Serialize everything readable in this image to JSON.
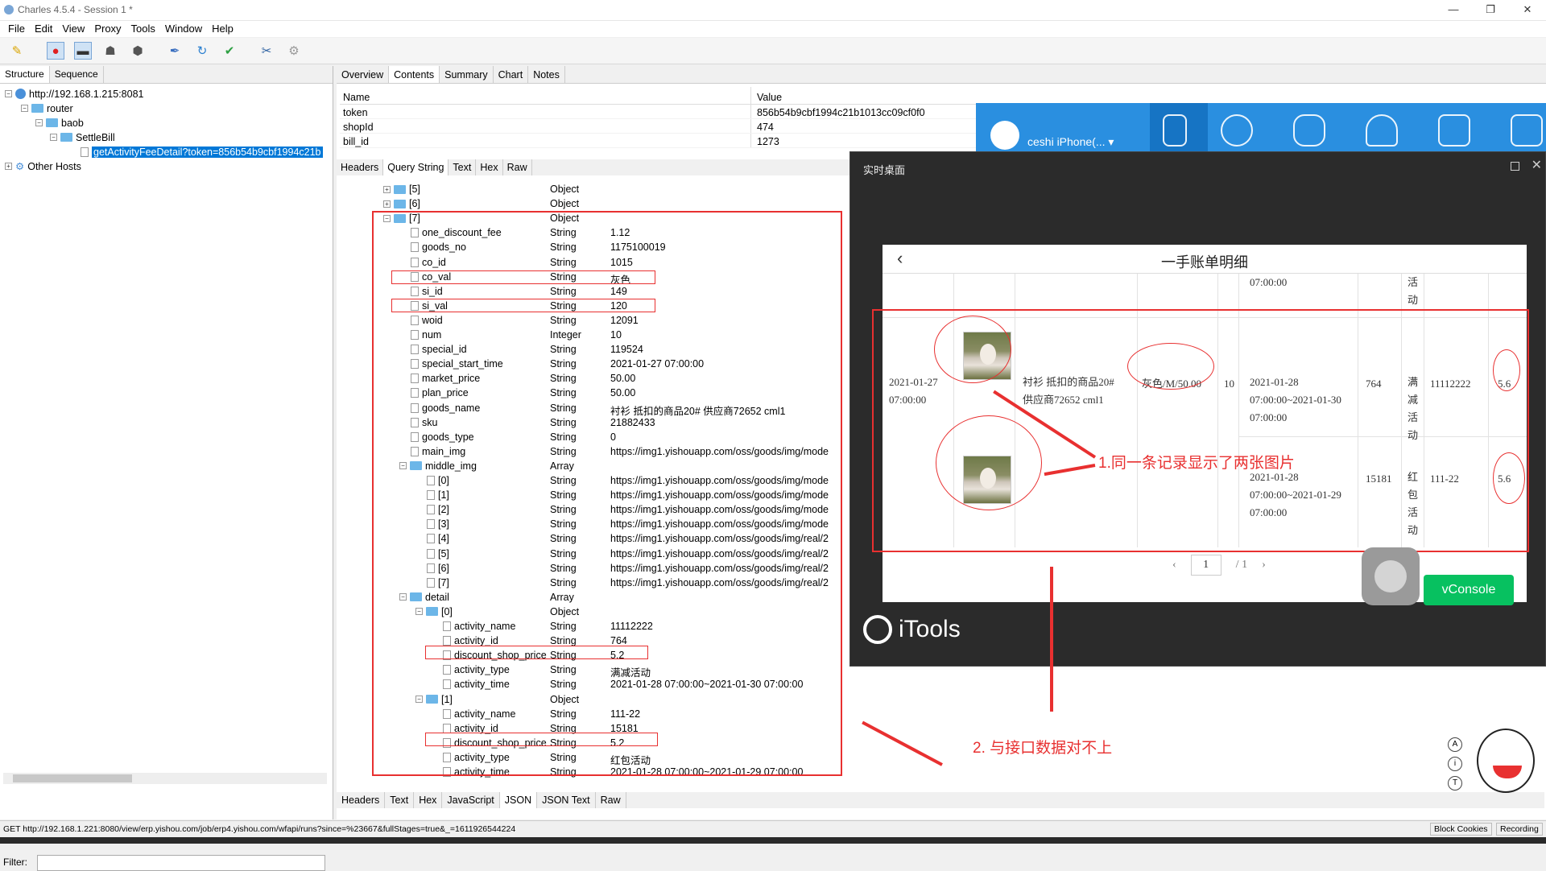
{
  "window": {
    "title": "Charles 4.5.4 - Session 1 *",
    "controls": [
      "—",
      "❐",
      "✕"
    ]
  },
  "menu": [
    "File",
    "Edit",
    "View",
    "Proxy",
    "Tools",
    "Window",
    "Help"
  ],
  "toolbar_icons": [
    "broom-icon",
    "record-icon",
    "throttle-icon",
    "turtle-icon",
    "stop-icon",
    "pen-icon",
    "refresh-icon",
    "check-icon",
    "tools-icon",
    "gear-icon"
  ],
  "left": {
    "tabs": [
      "Structure",
      "Sequence"
    ],
    "tree": [
      {
        "label": "http://192.168.1.215:8081",
        "level": 0,
        "kind": "globe"
      },
      {
        "label": "router",
        "level": 1,
        "kind": "folder"
      },
      {
        "label": "baob",
        "level": 2,
        "kind": "folder"
      },
      {
        "label": "SettleBill",
        "level": 3,
        "kind": "folder"
      },
      {
        "label": "getActivityFeeDetail?token=856b54b9cbf1994c21b",
        "level": 4,
        "kind": "doc",
        "selected": true
      },
      {
        "label": "Other Hosts",
        "level": 0,
        "kind": "gear"
      }
    ],
    "filter_label": "Filter:"
  },
  "right": {
    "tabs": [
      "Overview",
      "Contents",
      "Summary",
      "Chart",
      "Notes"
    ],
    "active_tab": "Contents",
    "query_table": {
      "headers": [
        "Name",
        "Value"
      ],
      "rows": [
        {
          "name": "token",
          "value": "856b54b9cbf1994c21b1013cc09cf0f0"
        },
        {
          "name": "shopId",
          "value": "474"
        },
        {
          "name": "bill_id",
          "value": "1273"
        }
      ]
    },
    "sub_tabs": [
      "Headers",
      "Query String",
      "Text",
      "Hex",
      "Raw"
    ],
    "bottom_tabs": [
      "Headers",
      "Text",
      "Hex",
      "JavaScript",
      "JSON",
      "JSON Text",
      "Raw"
    ],
    "json_rows": [
      {
        "key": "[5]",
        "type": "Object",
        "value": "",
        "indent": 0,
        "kind": "folder-collapsed"
      },
      {
        "key": "[6]",
        "type": "Object",
        "value": "",
        "indent": 0,
        "kind": "folder-collapsed"
      },
      {
        "key": "[7]",
        "type": "Object",
        "value": "",
        "indent": 0,
        "kind": "folder"
      },
      {
        "key": "one_discount_fee",
        "type": "String",
        "value": "1.12",
        "indent": 1,
        "kind": "doc"
      },
      {
        "key": "goods_no",
        "type": "String",
        "value": "1175100019",
        "indent": 1,
        "kind": "doc"
      },
      {
        "key": "co_id",
        "type": "String",
        "value": "1015",
        "indent": 1,
        "kind": "doc"
      },
      {
        "key": "co_val",
        "type": "String",
        "value": "灰色",
        "indent": 1,
        "kind": "doc"
      },
      {
        "key": "si_id",
        "type": "String",
        "value": "149",
        "indent": 1,
        "kind": "doc"
      },
      {
        "key": "si_val",
        "type": "String",
        "value": "120",
        "indent": 1,
        "kind": "doc"
      },
      {
        "key": "woid",
        "type": "String",
        "value": "12091",
        "indent": 1,
        "kind": "doc"
      },
      {
        "key": "num",
        "type": "Integer",
        "value": "10",
        "indent": 1,
        "kind": "doc"
      },
      {
        "key": "special_id",
        "type": "String",
        "value": "119524",
        "indent": 1,
        "kind": "doc"
      },
      {
        "key": "special_start_time",
        "type": "String",
        "value": "2021-01-27 07:00:00",
        "indent": 1,
        "kind": "doc"
      },
      {
        "key": "market_price",
        "type": "String",
        "value": "50.00",
        "indent": 1,
        "kind": "doc"
      },
      {
        "key": "plan_price",
        "type": "String",
        "value": "50.00",
        "indent": 1,
        "kind": "doc"
      },
      {
        "key": "goods_name",
        "type": "String",
        "value": "衬衫 抵扣的商品20# 供应商72652  cml1",
        "indent": 1,
        "kind": "doc"
      },
      {
        "key": "sku",
        "type": "String",
        "value": "21882433",
        "indent": 1,
        "kind": "doc"
      },
      {
        "key": "goods_type",
        "type": "String",
        "value": "0",
        "indent": 1,
        "kind": "doc"
      },
      {
        "key": "main_img",
        "type": "String",
        "value": "https://img1.yishouapp.com/oss/goods/img/mode",
        "indent": 1,
        "kind": "doc"
      },
      {
        "key": "middle_img",
        "type": "Array",
        "value": "",
        "indent": 1,
        "kind": "folder"
      },
      {
        "key": "[0]",
        "type": "String",
        "value": "https://img1.yishouapp.com/oss/goods/img/mode",
        "indent": 2,
        "kind": "doc"
      },
      {
        "key": "[1]",
        "type": "String",
        "value": "https://img1.yishouapp.com/oss/goods/img/mode",
        "indent": 2,
        "kind": "doc"
      },
      {
        "key": "[2]",
        "type": "String",
        "value": "https://img1.yishouapp.com/oss/goods/img/mode",
        "indent": 2,
        "kind": "doc"
      },
      {
        "key": "[3]",
        "type": "String",
        "value": "https://img1.yishouapp.com/oss/goods/img/mode",
        "indent": 2,
        "kind": "doc"
      },
      {
        "key": "[4]",
        "type": "String",
        "value": "https://img1.yishouapp.com/oss/goods/img/real/2",
        "indent": 2,
        "kind": "doc"
      },
      {
        "key": "[5]",
        "type": "String",
        "value": "https://img1.yishouapp.com/oss/goods/img/real/2",
        "indent": 2,
        "kind": "doc"
      },
      {
        "key": "[6]",
        "type": "String",
        "value": "https://img1.yishouapp.com/oss/goods/img/real/2",
        "indent": 2,
        "kind": "doc"
      },
      {
        "key": "[7]",
        "type": "String",
        "value": "https://img1.yishouapp.com/oss/goods/img/real/2",
        "indent": 2,
        "kind": "doc"
      },
      {
        "key": "detail",
        "type": "Array",
        "value": "",
        "indent": 1,
        "kind": "folder"
      },
      {
        "key": "[0]",
        "type": "Object",
        "value": "",
        "indent": 2,
        "kind": "folder"
      },
      {
        "key": "activity_name",
        "type": "String",
        "value": "11112222",
        "indent": 3,
        "kind": "doc"
      },
      {
        "key": "activity_id",
        "type": "String",
        "value": "764",
        "indent": 3,
        "kind": "doc"
      },
      {
        "key": "discount_shop_price",
        "type": "String",
        "value": "5.2",
        "indent": 3,
        "kind": "doc"
      },
      {
        "key": "activity_type",
        "type": "String",
        "value": "满减活动",
        "indent": 3,
        "kind": "doc"
      },
      {
        "key": "activity_time",
        "type": "String",
        "value": "2021-01-28 07:00:00~2021-01-30 07:00:00",
        "indent": 3,
        "kind": "doc"
      },
      {
        "key": "[1]",
        "type": "Object",
        "value": "",
        "indent": 2,
        "kind": "folder"
      },
      {
        "key": "activity_name",
        "type": "String",
        "value": "111-22",
        "indent": 3,
        "kind": "doc"
      },
      {
        "key": "activity_id",
        "type": "String",
        "value": "15181",
        "indent": 3,
        "kind": "doc"
      },
      {
        "key": "discount_shop_price",
        "type": "String",
        "value": "5.2",
        "indent": 3,
        "kind": "doc"
      },
      {
        "key": "activity_type",
        "type": "String",
        "value": "红包活动",
        "indent": 3,
        "kind": "doc"
      },
      {
        "key": "activity_time",
        "type": "String",
        "value": "2021-01-28 07:00:00~2021-01-29 07:00:00",
        "indent": 3,
        "kind": "doc"
      },
      {
        "key": "total",
        "type": "String",
        "value": "88.00",
        "indent": -1,
        "kind": "doc"
      }
    ]
  },
  "status": {
    "url": "GET http://192.168.1.221:8080/view/erp.yishou.com/job/erp4.yishou.com/wfapi/runs?since=%23667&fullStages=true&_=1611926544224",
    "buttons": [
      "Block Cookies",
      "Recording"
    ]
  },
  "itools": {
    "device": "ceshi iPhone(... ▾",
    "live_title": "实时桌面",
    "logo_text": "iTools",
    "phone": {
      "title": "一手账单明细",
      "top_partial": {
        "time": "07:00:00",
        "type": "活\n动"
      },
      "row": {
        "date": "2021-01-27\n07:00:00",
        "name": "衬衫 抵扣的商品20#\n供应商72652 cml1",
        "spec": "灰色/M/50.00",
        "qty": "10",
        "activities": [
          {
            "time": "2021-01-28\n07:00:00~2021-01-30\n07:00:00",
            "id": "764",
            "type": "满\n减\n活\n动",
            "name": "11112222",
            "price": "5.6"
          },
          {
            "time": "2021-01-28\n07:00:00~2021-01-29\n07:00:00",
            "id": "15181",
            "type": "红\n包\n活\n动",
            "name": "111-22",
            "price": "5.6"
          }
        ]
      },
      "pager": {
        "prev": "‹",
        "current": "1",
        "sep": "/",
        "total": "1",
        "next": "›"
      }
    },
    "vconsole": "vConsole"
  },
  "annotations": {
    "note1": "1.同一条记录显示了两张图片",
    "note2": "2. 与接口数据对不上"
  },
  "colors": {
    "accent": "#0078d7",
    "annotation": "#e83030",
    "itools_blue": "#2a8fe0",
    "vconsole": "#07c160"
  }
}
